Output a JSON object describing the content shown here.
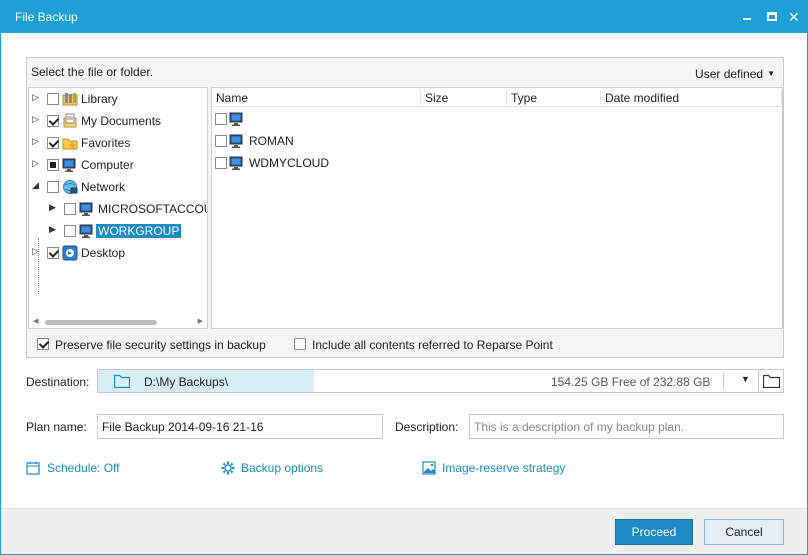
{
  "window": {
    "title": "File Backup"
  },
  "source": {
    "header": "Select the file or folder.",
    "view_mode": "User defined",
    "tree": [
      {
        "label": "Library",
        "checked": "off",
        "expander": "collapsed"
      },
      {
        "label": "My Documents",
        "checked": "on",
        "expander": "collapsed"
      },
      {
        "label": "Favorites",
        "checked": "on",
        "expander": "collapsed"
      },
      {
        "label": "Computer",
        "checked": "partial",
        "expander": "collapsed"
      },
      {
        "label": "Network",
        "checked": "off",
        "expander": "expanded"
      },
      {
        "label": "MICROSOFTACCOUN",
        "checked": "off",
        "expander": "collapsed"
      },
      {
        "label": "WORKGROUP",
        "checked": "off",
        "expander": "collapsed",
        "selected": true
      },
      {
        "label": "Desktop",
        "checked": "on",
        "expander": "collapsed"
      }
    ],
    "columns": [
      "Name",
      "Size",
      "Type",
      "Date modified"
    ],
    "items": [
      {
        "name": "",
        "icon": "computer-icon"
      },
      {
        "name": "ROMAN",
        "icon": "computer-icon"
      },
      {
        "name": "WDMYCLOUD",
        "icon": "computer-icon"
      }
    ],
    "options": {
      "preserve_security": "Preserve file security settings in backup",
      "include_reparse": "Include all contents referred to Reparse Point"
    }
  },
  "destination": {
    "label": "Destination:",
    "path": "D:\\My Backups\\",
    "free_space": "154.25 GB Free of 232.88 GB"
  },
  "plan": {
    "name_label": "Plan name:",
    "name_value": "File Backup 2014-09-16 21-16",
    "description_label": "Description:",
    "description_placeholder": "This is a description of my backup plan."
  },
  "links": {
    "schedule": "Schedule: Off",
    "backup_options": "Backup options",
    "image_reserve": "Image-reserve strategy"
  },
  "buttons": {
    "proceed": "Proceed",
    "cancel": "Cancel"
  },
  "colors": {
    "accent": "#1e9fd6",
    "link": "#1e8ac4",
    "selection": "#1e8ac4"
  }
}
